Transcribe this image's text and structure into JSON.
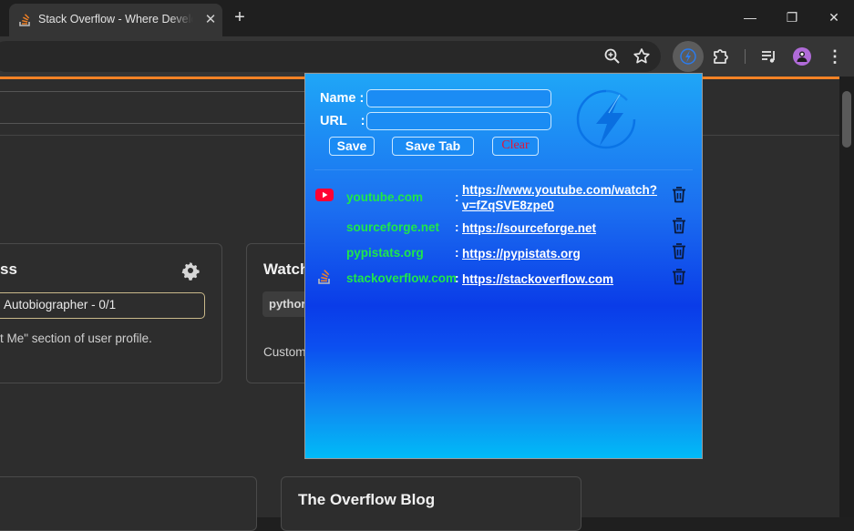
{
  "browser": {
    "tab": {
      "title": "Stack Overflow - Where Developers Learn, Share, & Build Careers",
      "close": "✕"
    },
    "new_tab": "+",
    "window": {
      "minimize": "—",
      "restore": "❐",
      "close": "✕"
    },
    "toolbar_icons": [
      "zoom-icon",
      "bookmark-star-icon",
      "extension-lightning-icon",
      "extensions-puzzle-icon",
      "media-queue-icon",
      "profile-avatar"
    ]
  },
  "page": {
    "card1": {
      "title": "ss",
      "badge": "Autobiographer - 0/1",
      "description": "t Me\" section of user profile."
    },
    "card2": {
      "title": "Watch",
      "tag": "pythor",
      "description": "Custom"
    },
    "blog": {
      "title": "The Overflow Blog"
    },
    "colors": {
      "accent": "#f48225"
    }
  },
  "popup": {
    "name_label": "Name :",
    "url_label": "URL :",
    "name_value": "",
    "url_value": "",
    "buttons": {
      "save": "Save",
      "save_tab": "Save Tab",
      "clear": "Clear"
    },
    "colors": {
      "domain": "#1fe74a",
      "clear": "#e0163a"
    },
    "bookmarks": [
      {
        "icon": "youtube-icon",
        "domain": "youtube.com",
        "url": "https://www.youtube.com/watch?v=fZqSVE8zpe0"
      },
      {
        "icon": "",
        "domain": "sourceforge.net",
        "url": "https://sourceforge.net"
      },
      {
        "icon": "",
        "domain": "pypistats.org",
        "url": "https://pypistats.org"
      },
      {
        "icon": "stackoverflow-icon",
        "domain": "stackoverflow.com",
        "url": "https://stackoverflow.com"
      }
    ],
    "separator": ":"
  }
}
